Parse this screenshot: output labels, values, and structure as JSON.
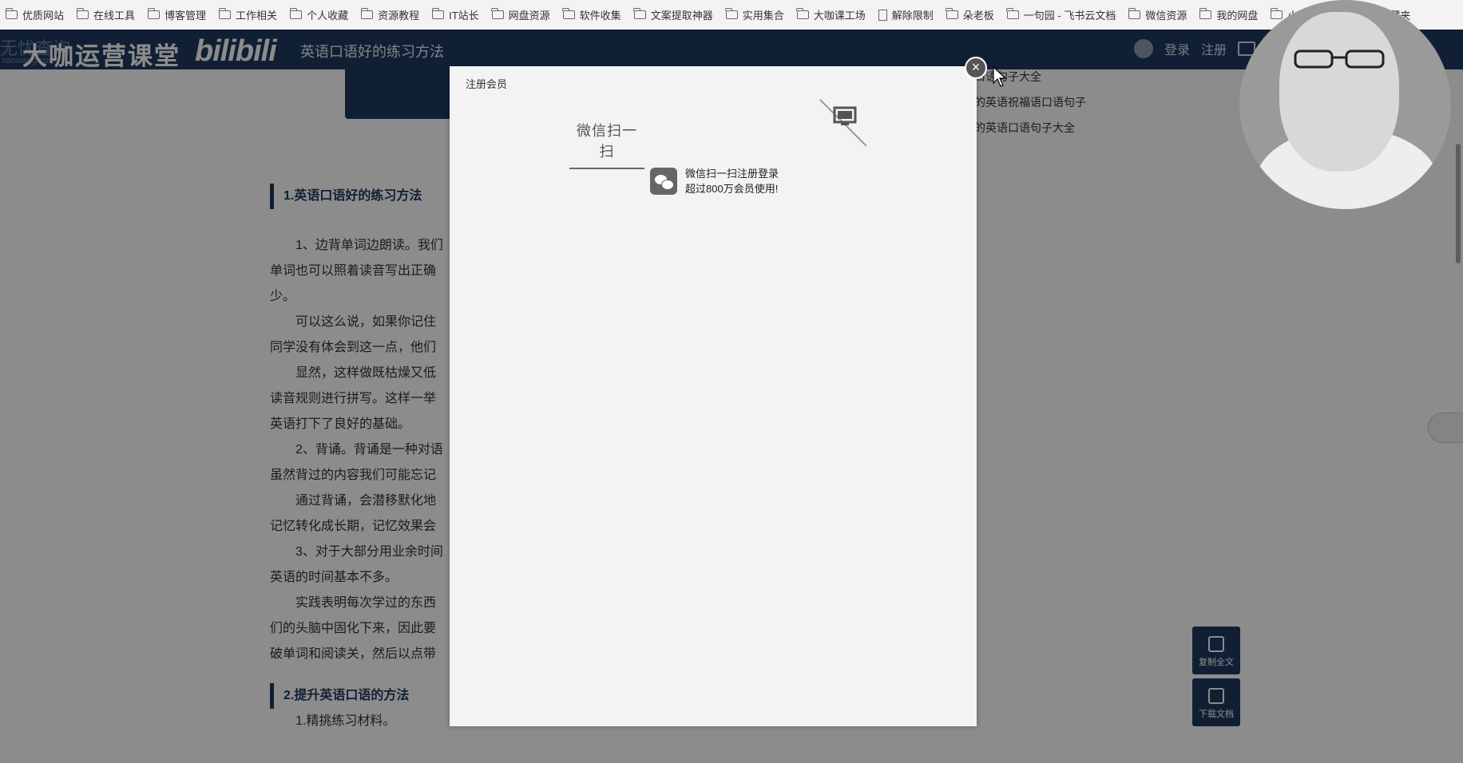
{
  "bookmarks": [
    {
      "label": "优质网站",
      "icon": "folder-icon"
    },
    {
      "label": "在线工具",
      "icon": "folder-icon"
    },
    {
      "label": "博客管理",
      "icon": "folder-icon"
    },
    {
      "label": "工作相关",
      "icon": "folder-icon"
    },
    {
      "label": "个人收藏",
      "icon": "folder-icon"
    },
    {
      "label": "资源教程",
      "icon": "folder-icon"
    },
    {
      "label": "IT站长",
      "icon": "folder-icon"
    },
    {
      "label": "网盘资源",
      "icon": "folder-icon"
    },
    {
      "label": "软件收集",
      "icon": "folder-icon"
    },
    {
      "label": "文案提取神器",
      "icon": "app-icon"
    },
    {
      "label": "实用集合",
      "icon": "folder-icon"
    },
    {
      "label": "大咖课工场",
      "icon": "folder-icon"
    },
    {
      "label": "解除限制",
      "icon": "document-icon"
    },
    {
      "label": "朵老板",
      "icon": "app-icon"
    },
    {
      "label": "一句园 - 飞书云文档",
      "icon": "app-icon"
    },
    {
      "label": "微信资源",
      "icon": "folder-icon"
    },
    {
      "label": "我的网盘",
      "icon": "folder-icon"
    },
    {
      "label": "小米云盘",
      "icon": "cloud-icon"
    },
    {
      "label": "其他收藏夹",
      "icon": "folder-icon"
    }
  ],
  "header": {
    "watermark": "无忧查询",
    "watermark_url": "xaowang.com",
    "brand": "大咖运营课堂",
    "bili": "bilibili",
    "page_title": "英语口语好的练习方法",
    "login": "登录",
    "register": "注册"
  },
  "related": [
    "口语句子大全",
    "的英语祝福语口语句子",
    "的英语口语句子大全"
  ],
  "article": {
    "section1_title": "1.英语口语好的练习方法",
    "paragraphs": [
      "1、边背单词边朗读。我们",
      "单词也可以照着读音写出正确",
      "少。",
      "可以这么说，如果你记住",
      "同学没有体会到这一点，他们",
      "显然，这样做既枯燥又低",
      "读音规则进行拼写。这样一举",
      "英语打下了良好的基础。",
      "2、背诵。背诵是一种对语",
      "虽然背过的内容我们可能忘记",
      "通过背诵，会潜移默化地",
      "记忆转化成长期，记忆效果会",
      "3、对于大部分用业余时间",
      "英语的时间基本不多。",
      "实践表明每次学过的东西",
      "们的头脑中固化下来，因此要",
      "破单词和阅读关，然后以点带"
    ],
    "section2_title": "2.提升英语口语的方法",
    "section2_first": "1.精挑练习材料。"
  },
  "tools": {
    "copy_all": "复制全文",
    "download": "下载文档"
  },
  "modal": {
    "title": "注册会员",
    "tab_label": "微信扫一扫",
    "info_line1": "微信扫一扫注册登录",
    "info_line2": "超过800万会员使用!",
    "close_symbol": "×"
  }
}
